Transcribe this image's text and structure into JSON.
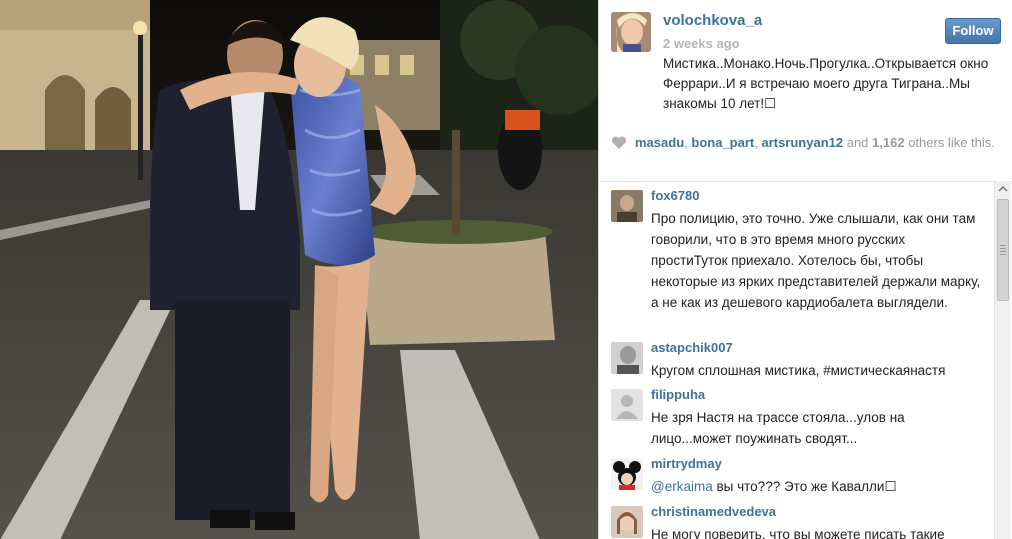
{
  "post": {
    "username": "volochkova_a",
    "time": "2 weeks ago",
    "follow_label": "Follow",
    "caption": "Мистика..Монако.Ночь.Прогулка..Открывается окно Феррари..И я встречаю моего друга Тиграна..Мы знакомы 10 лет!☐"
  },
  "likes": {
    "users": [
      "masadu",
      "bona_part",
      "artsrunyan12"
    ],
    "sep1": ", ",
    "sep2": ", ",
    "and_text": " and ",
    "count": "1,162",
    "suffix": " others like this."
  },
  "comments": [
    {
      "user": "fox6780",
      "text": "Про полицию, это точно. Уже слышали, как они там говорили, что в это время много русских простиТуток приехало. Хотелось бы, чтобы некоторые из ярких представителей держали марку, а не как из дешевого кардиобалета выглядели."
    },
    {
      "user": "astapchik007",
      "text": "Кругом сплошная мистика, #мистическаянастя"
    },
    {
      "user": "filippuha",
      "text": "Не зря Настя на трассе стояла...улов на лицо...может поужинать сводят..."
    },
    {
      "user": "mirtrydmay",
      "mention": "@erkaima",
      "text": " вы что??? Это же Кавалли☐"
    },
    {
      "user": "christinamedvedeva",
      "text": "Не могу поверить, что вы можете писать такие"
    }
  ],
  "icons": {
    "heart": "heart-icon",
    "scroll_up": "chevron-up-icon"
  },
  "colors": {
    "link": "#3f729b",
    "follow_button": "#4375ad",
    "muted": "#999999"
  }
}
